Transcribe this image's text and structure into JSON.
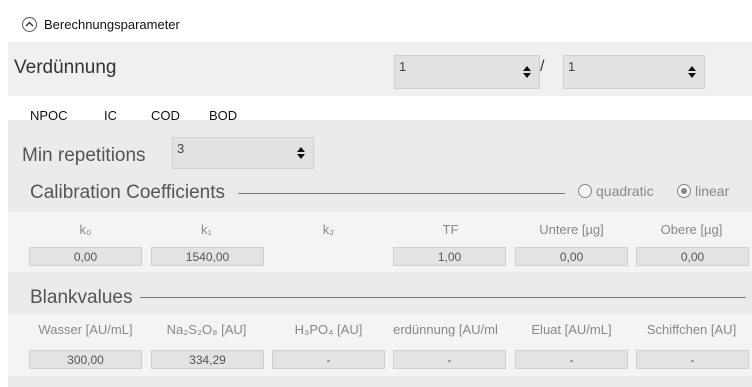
{
  "header": {
    "title": "Berechnungsparameter"
  },
  "verduennung": {
    "label": "Verdünnung",
    "value1": "1",
    "separator": "/",
    "value2": "1"
  },
  "tabs": [
    {
      "label": "NPOC"
    },
    {
      "label": "IC"
    },
    {
      "label": "COD"
    },
    {
      "label": "BOD"
    }
  ],
  "min_repetitions": {
    "label": "Min repetitions",
    "value": "3"
  },
  "calibration": {
    "title": "Calibration Coefficients",
    "options": [
      {
        "label": "quadratic",
        "selected": false
      },
      {
        "label": "linear",
        "selected": true
      }
    ],
    "columns": [
      "k₀",
      "k₁",
      "k₂",
      "TF",
      "Untere [µg]",
      "Obere [µg]"
    ],
    "values": [
      "0,00",
      "1540,00",
      "",
      "1,00",
      "0,00",
      "0,00"
    ]
  },
  "blankvalues": {
    "title": "Blankvalues",
    "columns": [
      "Wasser [AU/mL]",
      "Na₂S₂O₈ [AU]",
      "H₃PO₄ [AU]",
      "erdünnung [AU/ml",
      "Eluat [AU/mL]",
      "Schiffchen [AU]"
    ],
    "values": [
      "300,00",
      "334,29",
      "-",
      "-",
      "-",
      "-"
    ]
  },
  "colors": {
    "tab_underline": "#4aa8e0",
    "panel_bg": "#f0f0f0"
  }
}
